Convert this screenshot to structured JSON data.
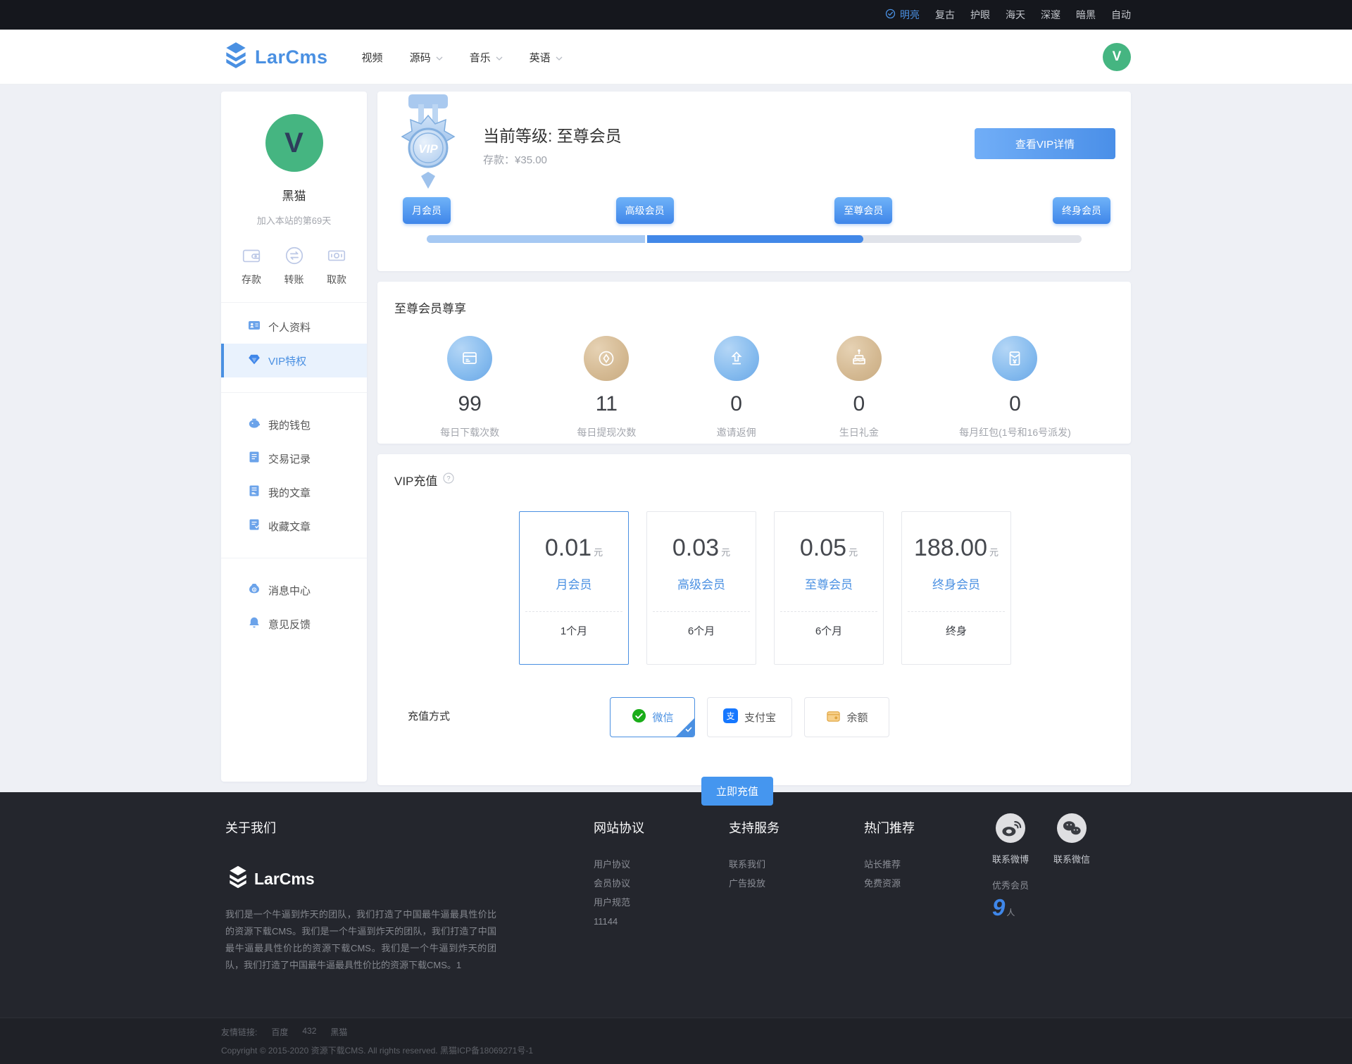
{
  "topbar": {
    "themes": [
      {
        "label": "明亮",
        "active": true
      },
      {
        "label": "复古",
        "active": false
      },
      {
        "label": "护眼",
        "active": false
      },
      {
        "label": "海天",
        "active": false
      },
      {
        "label": "深邃",
        "active": false
      },
      {
        "label": "暗黑",
        "active": false
      },
      {
        "label": "自动",
        "active": false
      }
    ]
  },
  "header": {
    "brand": "LarCms",
    "nav": [
      {
        "label": "视频",
        "has_dropdown": false
      },
      {
        "label": "源码",
        "has_dropdown": true
      },
      {
        "label": "音乐",
        "has_dropdown": true
      },
      {
        "label": "英语",
        "has_dropdown": true
      }
    ],
    "avatar_letter": "V"
  },
  "sidebar": {
    "avatar_letter": "V",
    "username": "黑猫",
    "joined": "加入本站的第69天",
    "actions": [
      {
        "label": "存款"
      },
      {
        "label": "转账"
      },
      {
        "label": "取款"
      }
    ],
    "menu": [
      {
        "label": "个人资料"
      },
      {
        "label": "VIP特权",
        "active": true
      },
      {
        "label": "我的钱包"
      },
      {
        "label": "交易记录"
      },
      {
        "label": "我的文章"
      },
      {
        "label": "收藏文章"
      },
      {
        "label": "消息中心"
      },
      {
        "label": "意见反馈"
      }
    ]
  },
  "vip_status": {
    "medal_text": "VIP",
    "level_title": "当前等级: 至尊会员",
    "deposit_label": "存款：",
    "deposit_value": "¥35.00",
    "detail_button": "查看VIP详情",
    "levels": [
      "月会员",
      "高级会员",
      "至尊会员",
      "终身会员"
    ],
    "progress_percent": 66.7
  },
  "benefits": {
    "title": "至尊会员尊享",
    "items": [
      {
        "value": "99",
        "label": "每日下载次数",
        "tone": "blue",
        "icon": "download-card-icon"
      },
      {
        "value": "11",
        "label": "每日提现次数",
        "tone": "tan",
        "icon": "withdraw-diamond-icon"
      },
      {
        "value": "0",
        "label": "邀请返佣",
        "tone": "blue",
        "icon": "invite-upload-icon"
      },
      {
        "value": "0",
        "label": "生日礼金",
        "tone": "tan",
        "icon": "birthday-cake-icon"
      },
      {
        "value": "0",
        "label": "每月红包(1号和16号派发)",
        "tone": "blue",
        "icon": "red-envelope-icon"
      }
    ]
  },
  "recharge": {
    "title": "VIP充值",
    "plans": [
      {
        "price": "0.01",
        "unit": "元",
        "name": "月会员",
        "duration": "1个月",
        "selected": true
      },
      {
        "price": "0.03",
        "unit": "元",
        "name": "高级会员",
        "duration": "6个月",
        "selected": false
      },
      {
        "price": "0.05",
        "unit": "元",
        "name": "至尊会员",
        "duration": "6个月",
        "selected": false
      },
      {
        "price": "188.00",
        "unit": "元",
        "name": "终身会员",
        "duration": "终身",
        "selected": false
      }
    ],
    "method_label": "充值方式",
    "methods": [
      {
        "label": "微信",
        "selected": true,
        "icon": "wechat-pay-icon"
      },
      {
        "label": "支付宝",
        "selected": false,
        "icon": "alipay-icon"
      },
      {
        "label": "余额",
        "selected": false,
        "icon": "balance-wallet-icon"
      }
    ],
    "submit_label": "立即充值"
  },
  "footer": {
    "about": {
      "title": "关于我们",
      "brand": "LarCms",
      "text": "我们是一个牛逼到炸天的团队，我们打造了中国最牛逼最具性价比的资源下载CMS。我们是一个牛逼到炸天的团队，我们打造了中国最牛逼最具性价比的资源下载CMS。我们是一个牛逼到炸天的团队，我们打造了中国最牛逼最具性价比的资源下载CMS。1"
    },
    "columns": [
      {
        "title": "网站协议",
        "links": [
          "用户协议",
          "会员协议",
          "用户规范",
          "11144"
        ]
      },
      {
        "title": "支持服务",
        "links": [
          "联系我们",
          "广告投放"
        ]
      },
      {
        "title": "热门推荐",
        "links": [
          "站长推荐",
          "免费资源"
        ]
      }
    ],
    "social": [
      {
        "label": "联系微博",
        "icon": "weibo-icon"
      },
      {
        "label": "联系微信",
        "icon": "wechat-icon"
      }
    ],
    "member_label": "优秀会员",
    "member_count": "9",
    "member_unit": "人",
    "bottom": {
      "links_label": "友情链接:",
      "links": [
        "百度",
        "432",
        "黑猫"
      ],
      "copyright": "Copyright © 2015-2020 资源下载CMS. All rights reserved. 黑猫ICP备18069271号-1"
    }
  },
  "colors": {
    "accent": "#4a90e2",
    "chip_gradient_start": "#6fb2f8",
    "chip_gradient_end": "#3f86e9",
    "stat_blue": "#85bbee",
    "stat_tan": "#d4b992",
    "avatar_green": "#45b581",
    "footer_bg": "#24262d",
    "page_bg": "#eef0f5"
  }
}
